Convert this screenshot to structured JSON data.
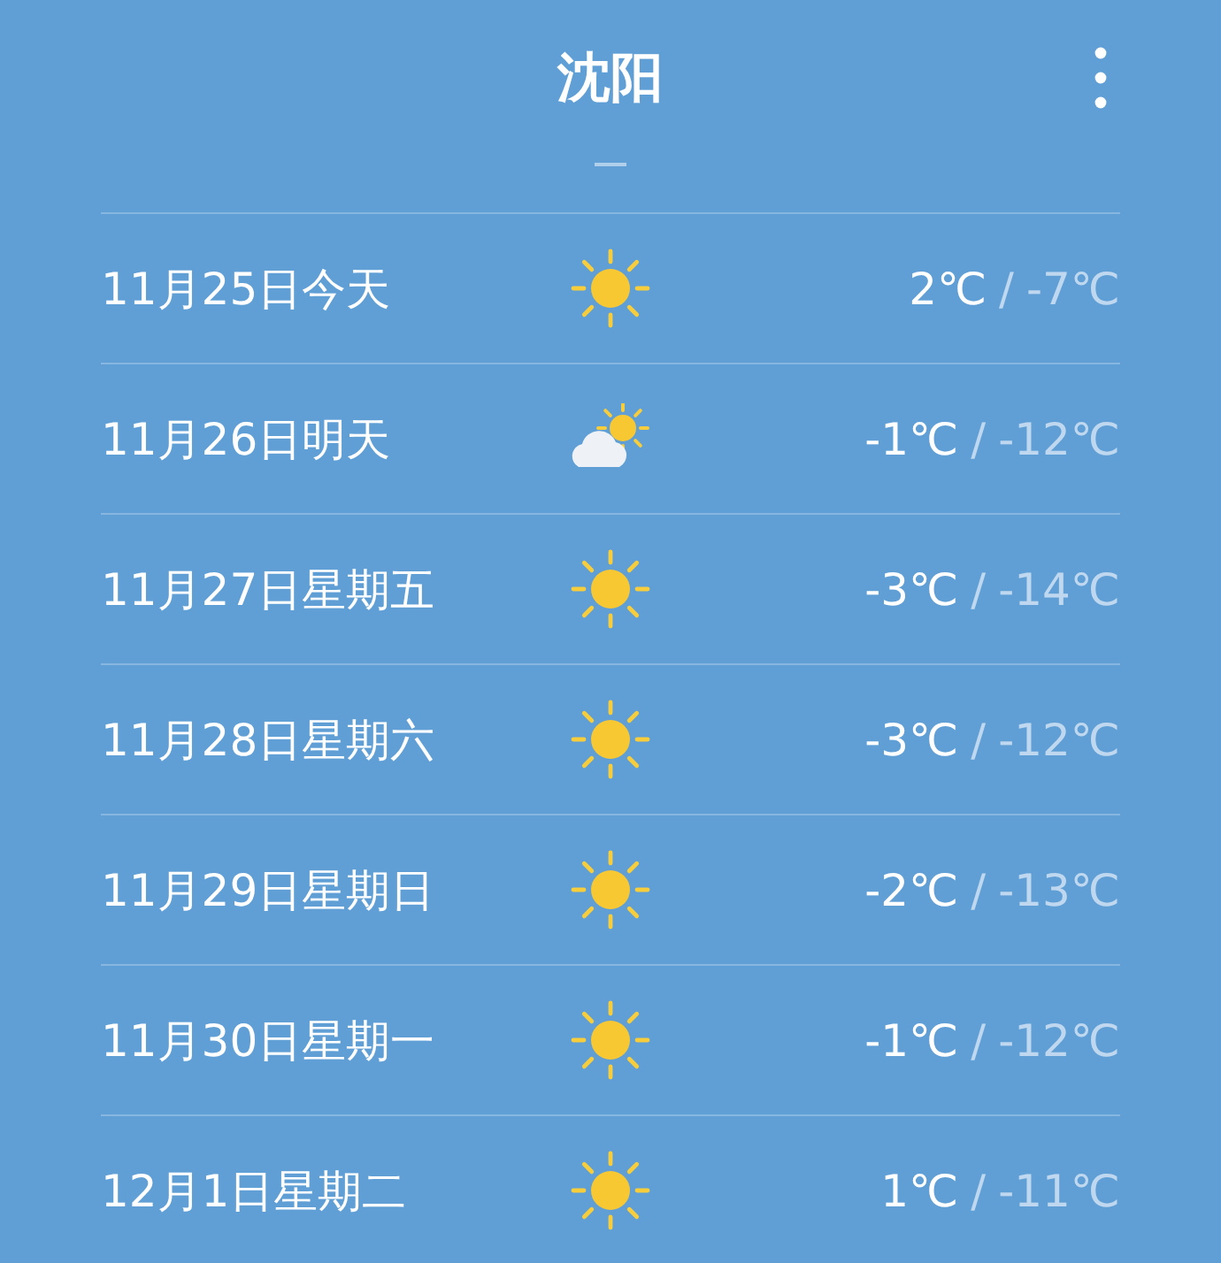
{
  "header": {
    "title": "沈阳"
  },
  "forecast": [
    {
      "date": "11月25日今天",
      "kind": "sunny",
      "high": "2℃",
      "separator": "/",
      "low": "-7℃"
    },
    {
      "date": "11月26日明天",
      "kind": "partly-cloudy",
      "high": "-1℃",
      "separator": "/",
      "low": "-12℃"
    },
    {
      "date": "11月27日星期五",
      "kind": "sunny",
      "high": "-3℃",
      "separator": "/",
      "low": "-14℃"
    },
    {
      "date": "11月28日星期六",
      "kind": "sunny",
      "high": "-3℃",
      "separator": "/",
      "low": "-12℃"
    },
    {
      "date": "11月29日星期日",
      "kind": "sunny",
      "high": "-2℃",
      "separator": "/",
      "low": "-13℃"
    },
    {
      "date": "11月30日星期一",
      "kind": "sunny",
      "high": "-1℃",
      "separator": "/",
      "low": "-12℃"
    },
    {
      "date": "12月1日星期二",
      "kind": "sunny",
      "high": "1℃",
      "separator": "/",
      "low": "-11℃"
    }
  ]
}
